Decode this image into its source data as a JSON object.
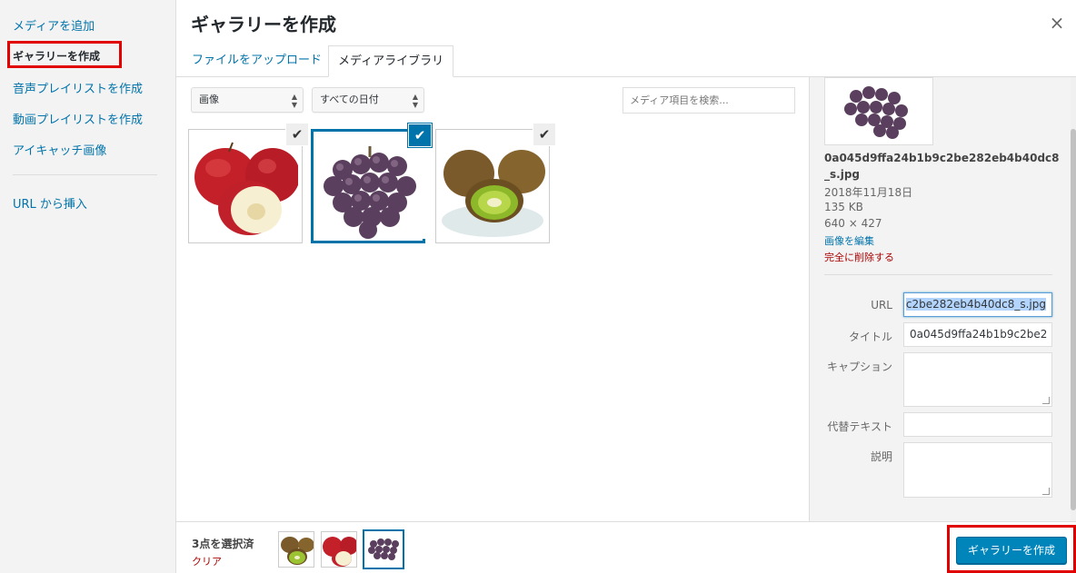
{
  "menu": {
    "items": [
      {
        "label": "メディアを追加"
      },
      {
        "label": "ギャラリーを作成"
      },
      {
        "label": "音声プレイリストを作成"
      },
      {
        "label": "動画プレイリストを作成"
      },
      {
        "label": "アイキャッチ画像"
      },
      {
        "label": "URL から挿入"
      }
    ],
    "active_index": 1
  },
  "frame": {
    "title": "ギャラリーを作成",
    "close_icon": "×"
  },
  "tabs": [
    {
      "label": "ファイルをアップロード"
    },
    {
      "label": "メディアライブラリ"
    }
  ],
  "toolbar": {
    "filter_type": "画像",
    "filter_date": "すべての日付",
    "search_placeholder": "メディア項目を検索..."
  },
  "attachments": [
    {
      "name": "apple",
      "selected": true,
      "details": false
    },
    {
      "name": "grapes",
      "selected": true,
      "details": true
    },
    {
      "name": "kiwi",
      "selected": true,
      "details": false
    }
  ],
  "details": {
    "filename": "0a045d9ffa24b1b9c2be282eb4b40dc8_s.jpg",
    "date": "2018年11月18日",
    "size": "135 KB",
    "dimensions": "640 × 427",
    "edit_link": "画像を編集",
    "delete_link": "完全に削除する",
    "url_label": "URL",
    "url_value": "c2be282eb4b40dc8_s.jpg",
    "title_label": "タイトル",
    "title_value": "0a045d9ffa24b1b9c2be2",
    "caption_label": "キャプション",
    "alt_label": "代替テキスト",
    "description_label": "説明"
  },
  "bottom": {
    "selection_count": "3点を選択済",
    "clear_label": "クリア",
    "primary_button": "ギャラリーを作成"
  },
  "colors": {
    "accent": "#0073aa",
    "primary": "#0085ba",
    "danger": "#a00",
    "highlight_box": "#e00000"
  }
}
